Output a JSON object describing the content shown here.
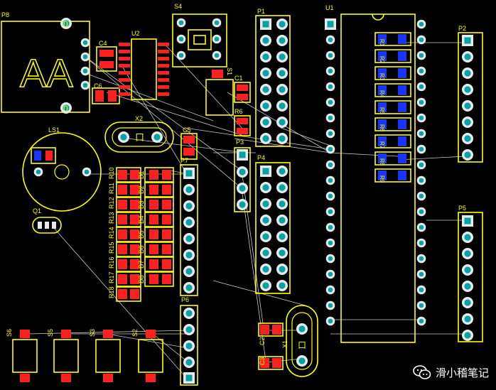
{
  "board": {
    "labels": {
      "p8": "P8",
      "s4": "S4",
      "p1": "P1",
      "u1": "U1",
      "p2": "P2",
      "c4": "C4",
      "u2": "U2",
      "c6": "C6",
      "c1": "C1",
      "s1": "S1",
      "r6": "R6",
      "x2": "X2",
      "c5": "C5",
      "ls1": "LS1",
      "p3": "P3",
      "p4": "P4",
      "p7": "P7",
      "q1": "Q1",
      "p5": "P5",
      "p6": "P6",
      "s6": "S6",
      "s5": "S5",
      "s3": "S3",
      "s2": "S2",
      "c2": "C2",
      "c3": "C3",
      "x1": "X1"
    },
    "resistors_right": [
      "R1",
      "R2",
      "R3",
      "R4",
      "R5",
      "R6",
      "R7",
      "R8",
      "R9"
    ],
    "resistors_left": [
      "R10",
      "R11",
      "R12",
      "R13",
      "R14",
      "R15",
      "R16",
      "R17",
      "R18"
    ],
    "leds": [
      "D1",
      "D2",
      "D3",
      "D4",
      "D5",
      "D6",
      "D7",
      "D8"
    ],
    "crystal_mark": "口",
    "zero_mark": "0",
    "aa_mark": "AA"
  },
  "watermark": {
    "text": "滑小稽笔记"
  },
  "colors": {
    "silkscreen": "#ffff00",
    "pad": "#00a3a3",
    "pad_ring": "#e8e8e8",
    "smd_red": "#ff2020",
    "smd_blue": "#1a35ff",
    "ratsnest": "#c8c8c8",
    "background": "#000000"
  }
}
